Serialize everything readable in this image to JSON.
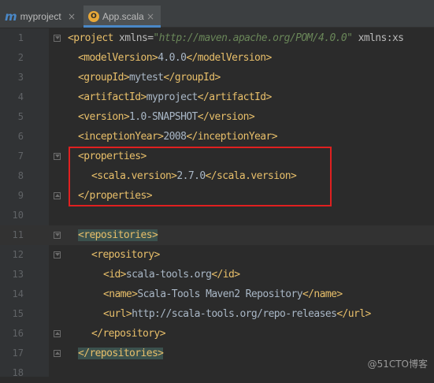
{
  "tabs": [
    {
      "icon": "maven-module-icon",
      "glyph": "m",
      "label": "myproject",
      "close": "×"
    },
    {
      "icon": "scala-object-icon",
      "glyph": "O",
      "label": "App.scala",
      "close": "×"
    }
  ],
  "lines": {
    "n1": "1",
    "n2": "2",
    "n3": "3",
    "n4": "4",
    "n5": "5",
    "n6": "6",
    "n7": "7",
    "n8": "8",
    "n9": "9",
    "n10": "10",
    "n11": "11",
    "n12": "12",
    "n13": "13",
    "n14": "14",
    "n15": "15",
    "n16": "16",
    "n17": "17",
    "n18": "18"
  },
  "code": {
    "l1": {
      "open": "<project",
      "attr1": " xmlns=",
      "val1": "\"http://maven.apache.org/POM/4.0.0\"",
      "attr2": " xmlns:xs"
    },
    "l2": {
      "open": "<modelVersion>",
      "text": "4.0.0",
      "close": "</modelVersion>"
    },
    "l3": {
      "open": "<groupId>",
      "text": "mytest",
      "close": "</groupId>"
    },
    "l4": {
      "open": "<artifactId>",
      "text": "myproject",
      "close": "</artifactId>"
    },
    "l5": {
      "open": "<version>",
      "text": "1.0-SNAPSHOT",
      "close": "</version>"
    },
    "l6": {
      "open": "<inceptionYear>",
      "text": "2008",
      "close": "</inceptionYear>"
    },
    "l7": {
      "open": "<properties>"
    },
    "l8": {
      "open": "<scala.version>",
      "text": "2.7.0",
      "close": "</scala.version>"
    },
    "l9": {
      "close": "</properties>"
    },
    "l11": {
      "open": "<repositories>"
    },
    "l12": {
      "open": "<repository>"
    },
    "l13": {
      "open": "<id>",
      "text": "scala-tools.org",
      "close": "</id>"
    },
    "l14": {
      "open": "<name>",
      "text": "Scala-Tools Maven2 Repository",
      "close": "</name>"
    },
    "l15": {
      "open": "<url>",
      "text": "http://scala-tools.org/repo-releases",
      "close": "</url>"
    },
    "l16": {
      "close": "</repository>"
    },
    "l17": {
      "close": "</repositories>"
    }
  },
  "watermark": "@51CTO博客",
  "colors": {
    "editor_bg": "#2b2b2b",
    "tag": "#e8bf6a",
    "string": "#6a8759",
    "text": "#a9b7c6",
    "highlight_box": "#e02020"
  }
}
